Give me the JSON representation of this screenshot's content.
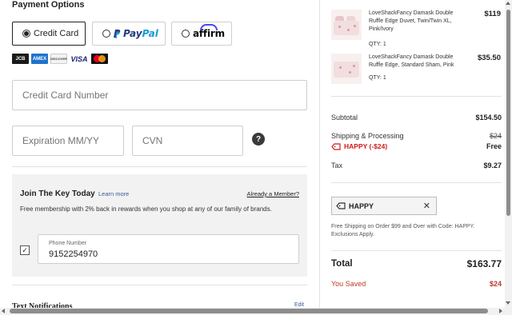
{
  "payment": {
    "title": "Payment Options",
    "options": {
      "credit_card": "Credit Card",
      "paypal_pay": "Pay",
      "paypal_pal": "Pal",
      "affirm": "affirm",
      "selected": "credit_card"
    },
    "card_logos": [
      "jcb-logo",
      "amex-logo",
      "discover-logo",
      "visa-logo",
      "mastercard-logo"
    ],
    "card_logo_text": {
      "jcb": "JCB",
      "amex": "AMEX",
      "discover": "DISCOVER",
      "visa": "VISA"
    },
    "fields": {
      "card_number_placeholder": "Credit Card Number",
      "expiration_placeholder": "Expiration MM/YY",
      "cvn_placeholder": "CVN"
    },
    "help_icon": "?"
  },
  "join": {
    "title": "Join The Key Today",
    "learn_more": "Learn more",
    "already_member": "Already a Member?",
    "description": "Free membership with 2% back in rewards when you shop at any of our family of brands.",
    "checkbox_checked": true,
    "checkbox_mark": "✓",
    "phone_label": "Phone Number",
    "phone_value": "9152254970"
  },
  "notifications": {
    "title": "Text Notifications",
    "edit": "Edit"
  },
  "order": {
    "items": [
      {
        "name": "LoveShackFancy Damask Double Ruffle Edge Duvet, Twin/Twin XL, Pink/Ivory",
        "qty": "QTY: 1",
        "price": "$119"
      },
      {
        "name": "LoveShackFancy Damask Double Ruffle Edge, Standard Sham, Pink",
        "qty": "QTY: 1",
        "price": "$35.50"
      }
    ],
    "subtotal_label": "Subtotal",
    "subtotal_value": "$154.50",
    "shipping_label": "Shipping & Processing",
    "shipping_original": "$24",
    "shipping_value": "Free",
    "promo_label": "HAPPY (-$24)",
    "tax_label": "Tax",
    "tax_value": "$9.27",
    "coupon_code": "HAPPY",
    "coupon_remove": "✕",
    "free_shipping_note": "Free Shipping on Order $99 and Over with Code: HAPPY. Exclusions Apply.",
    "total_label": "Total",
    "total_value": "$163.77",
    "saved_label": "You Saved",
    "saved_value": "$24"
  },
  "colors": {
    "accent_red": "#c0392b",
    "link_blue": "#3c5a94",
    "panel_grey": "#f2f2f2"
  }
}
